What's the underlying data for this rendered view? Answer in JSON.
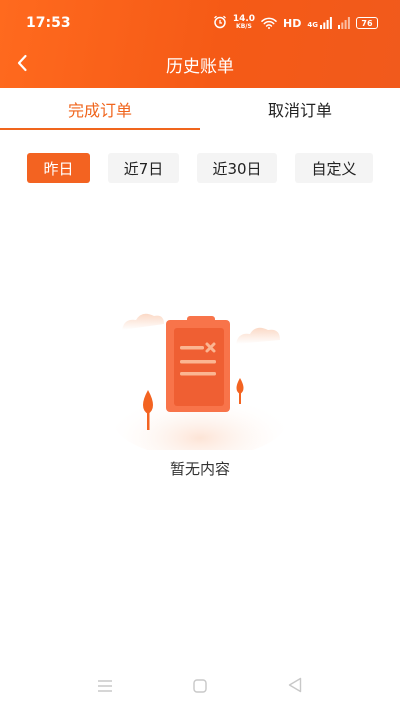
{
  "status_bar": {
    "time": "17:53",
    "net_speed_value": "14.0",
    "net_speed_unit": "KB/S",
    "hd_label": "HD",
    "signal_label": "4G",
    "battery": "76"
  },
  "header": {
    "title": "历史账单",
    "back_icon": "chevron-left-icon"
  },
  "tabs": [
    {
      "label": "完成订单",
      "active": true
    },
    {
      "label": "取消订单",
      "active": false
    }
  ],
  "filters": [
    {
      "label": "昨日",
      "active": true
    },
    {
      "label": "近7日",
      "active": false
    },
    {
      "label": "近30日",
      "active": false
    },
    {
      "label": "自定义",
      "active": false
    }
  ],
  "empty_state": {
    "message": "暂无内容",
    "icon": "empty-clipboard-illustration"
  },
  "system_nav": {
    "menu_icon": "menu-icon",
    "home_icon": "home-square-icon",
    "back_icon": "back-triangle-icon"
  },
  "colors": {
    "accent": "#f36321",
    "header_gradient_start": "#ff6a1e",
    "header_gradient_end": "#f15a1c",
    "text_primary": "#222222"
  }
}
